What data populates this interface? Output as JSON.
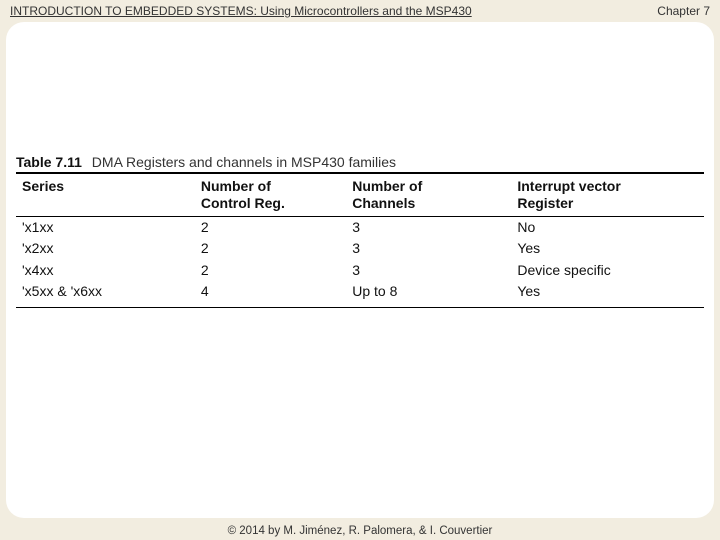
{
  "header": {
    "left": "INTRODUCTION TO EMBEDDED SYSTEMS: Using Microcontrollers and the MSP430",
    "right": "Chapter 7"
  },
  "footer": {
    "copyright": "© 2014 by M. Jiménez, R. Palomera, & I. Couvertier"
  },
  "table": {
    "number": "Table 7.11",
    "title": "DMA Registers and channels in MSP430 families",
    "columns": {
      "series": "Series",
      "control": "Number of\nControl Reg.",
      "channels": "Number of\nChannels",
      "irq": "Interrupt vector\nRegister"
    },
    "rows": [
      {
        "series": "'x1xx",
        "control": "2",
        "channels": "3",
        "irq": "No"
      },
      {
        "series": "'x2xx",
        "control": "2",
        "channels": "3",
        "irq": "Yes"
      },
      {
        "series": "'x4xx",
        "control": "2",
        "channels": "3",
        "irq": "Device specific"
      },
      {
        "series": "'x5xx & 'x6xx",
        "control": "4",
        "channels": "Up to 8",
        "irq": "Yes"
      }
    ]
  }
}
